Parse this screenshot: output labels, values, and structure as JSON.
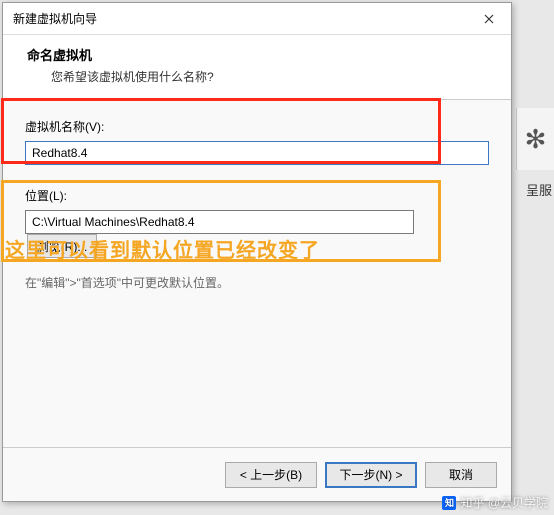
{
  "titlebar": {
    "title": "新建虚拟机向导"
  },
  "header": {
    "title": "命名虚拟机",
    "desc": "您希望该虚拟机使用什么名称?"
  },
  "form": {
    "name_label": "虚拟机名称(V):",
    "name_value": "Redhat8.4",
    "location_label": "位置(L):",
    "location_value": "C:\\Virtual Machines\\Redhat8.4",
    "browse_label": "浏览(R)...",
    "hint": "在\"编辑\">\"首选项\"中可更改默认位置。"
  },
  "annotation": {
    "text": "这里可以看到默认位置已经改变了"
  },
  "buttons": {
    "back": "< 上一步(B)",
    "next": "下一步(N) >",
    "cancel": "取消"
  },
  "side": {
    "label": "呈服"
  },
  "watermark": {
    "text": "知乎 @云贝学院"
  }
}
